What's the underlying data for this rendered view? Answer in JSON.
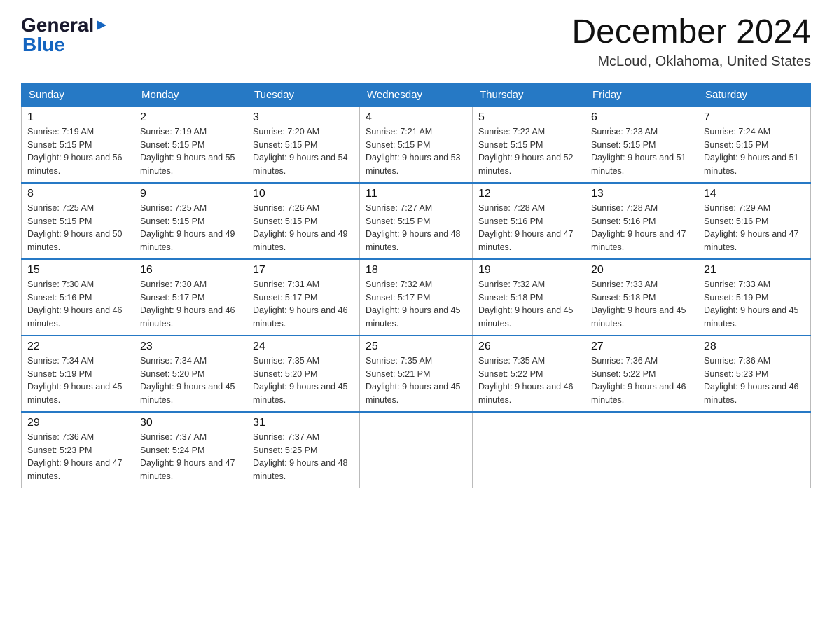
{
  "header": {
    "logo_line1": "General",
    "logo_line2": "Blue",
    "month_title": "December 2024",
    "location": "McLoud, Oklahoma, United States"
  },
  "weekdays": [
    "Sunday",
    "Monday",
    "Tuesday",
    "Wednesday",
    "Thursday",
    "Friday",
    "Saturday"
  ],
  "weeks": [
    [
      {
        "day": "1",
        "sunrise": "7:19 AM",
        "sunset": "5:15 PM",
        "daylight": "9 hours and 56 minutes."
      },
      {
        "day": "2",
        "sunrise": "7:19 AM",
        "sunset": "5:15 PM",
        "daylight": "9 hours and 55 minutes."
      },
      {
        "day": "3",
        "sunrise": "7:20 AM",
        "sunset": "5:15 PM",
        "daylight": "9 hours and 54 minutes."
      },
      {
        "day": "4",
        "sunrise": "7:21 AM",
        "sunset": "5:15 PM",
        "daylight": "9 hours and 53 minutes."
      },
      {
        "day": "5",
        "sunrise": "7:22 AM",
        "sunset": "5:15 PM",
        "daylight": "9 hours and 52 minutes."
      },
      {
        "day": "6",
        "sunrise": "7:23 AM",
        "sunset": "5:15 PM",
        "daylight": "9 hours and 51 minutes."
      },
      {
        "day": "7",
        "sunrise": "7:24 AM",
        "sunset": "5:15 PM",
        "daylight": "9 hours and 51 minutes."
      }
    ],
    [
      {
        "day": "8",
        "sunrise": "7:25 AM",
        "sunset": "5:15 PM",
        "daylight": "9 hours and 50 minutes."
      },
      {
        "day": "9",
        "sunrise": "7:25 AM",
        "sunset": "5:15 PM",
        "daylight": "9 hours and 49 minutes."
      },
      {
        "day": "10",
        "sunrise": "7:26 AM",
        "sunset": "5:15 PM",
        "daylight": "9 hours and 49 minutes."
      },
      {
        "day": "11",
        "sunrise": "7:27 AM",
        "sunset": "5:15 PM",
        "daylight": "9 hours and 48 minutes."
      },
      {
        "day": "12",
        "sunrise": "7:28 AM",
        "sunset": "5:16 PM",
        "daylight": "9 hours and 47 minutes."
      },
      {
        "day": "13",
        "sunrise": "7:28 AM",
        "sunset": "5:16 PM",
        "daylight": "9 hours and 47 minutes."
      },
      {
        "day": "14",
        "sunrise": "7:29 AM",
        "sunset": "5:16 PM",
        "daylight": "9 hours and 47 minutes."
      }
    ],
    [
      {
        "day": "15",
        "sunrise": "7:30 AM",
        "sunset": "5:16 PM",
        "daylight": "9 hours and 46 minutes."
      },
      {
        "day": "16",
        "sunrise": "7:30 AM",
        "sunset": "5:17 PM",
        "daylight": "9 hours and 46 minutes."
      },
      {
        "day": "17",
        "sunrise": "7:31 AM",
        "sunset": "5:17 PM",
        "daylight": "9 hours and 46 minutes."
      },
      {
        "day": "18",
        "sunrise": "7:32 AM",
        "sunset": "5:17 PM",
        "daylight": "9 hours and 45 minutes."
      },
      {
        "day": "19",
        "sunrise": "7:32 AM",
        "sunset": "5:18 PM",
        "daylight": "9 hours and 45 minutes."
      },
      {
        "day": "20",
        "sunrise": "7:33 AM",
        "sunset": "5:18 PM",
        "daylight": "9 hours and 45 minutes."
      },
      {
        "day": "21",
        "sunrise": "7:33 AM",
        "sunset": "5:19 PM",
        "daylight": "9 hours and 45 minutes."
      }
    ],
    [
      {
        "day": "22",
        "sunrise": "7:34 AM",
        "sunset": "5:19 PM",
        "daylight": "9 hours and 45 minutes."
      },
      {
        "day": "23",
        "sunrise": "7:34 AM",
        "sunset": "5:20 PM",
        "daylight": "9 hours and 45 minutes."
      },
      {
        "day": "24",
        "sunrise": "7:35 AM",
        "sunset": "5:20 PM",
        "daylight": "9 hours and 45 minutes."
      },
      {
        "day": "25",
        "sunrise": "7:35 AM",
        "sunset": "5:21 PM",
        "daylight": "9 hours and 45 minutes."
      },
      {
        "day": "26",
        "sunrise": "7:35 AM",
        "sunset": "5:22 PM",
        "daylight": "9 hours and 46 minutes."
      },
      {
        "day": "27",
        "sunrise": "7:36 AM",
        "sunset": "5:22 PM",
        "daylight": "9 hours and 46 minutes."
      },
      {
        "day": "28",
        "sunrise": "7:36 AM",
        "sunset": "5:23 PM",
        "daylight": "9 hours and 46 minutes."
      }
    ],
    [
      {
        "day": "29",
        "sunrise": "7:36 AM",
        "sunset": "5:23 PM",
        "daylight": "9 hours and 47 minutes."
      },
      {
        "day": "30",
        "sunrise": "7:37 AM",
        "sunset": "5:24 PM",
        "daylight": "9 hours and 47 minutes."
      },
      {
        "day": "31",
        "sunrise": "7:37 AM",
        "sunset": "5:25 PM",
        "daylight": "9 hours and 48 minutes."
      },
      null,
      null,
      null,
      null
    ]
  ],
  "labels": {
    "sunrise": "Sunrise:",
    "sunset": "Sunset:",
    "daylight": "Daylight:"
  }
}
